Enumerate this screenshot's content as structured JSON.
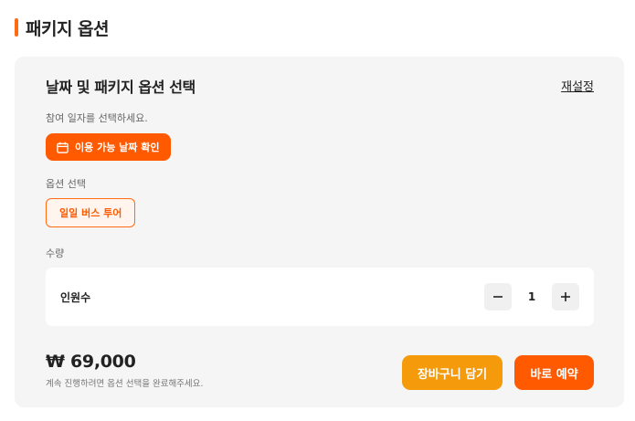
{
  "section": {
    "title": "패키지 옵션"
  },
  "panel": {
    "heading": "날짜 및 패키지 옵션 선택",
    "reset_label": "재설정",
    "date_label": "참여 일자를 선택하세요.",
    "date_button_label": "이용 가능 날짜 확인",
    "date_button_icon": "calendar-icon",
    "option_label": "옵션 선택",
    "options": [
      {
        "label": "일일 버스 투어",
        "selected": true
      }
    ],
    "quantity_label": "수량",
    "quantity": {
      "name": "인원수",
      "value": "1",
      "minus_icon": "minus-icon",
      "plus_icon": "plus-icon"
    },
    "price": "₩ 69,000",
    "hint": "계속 진행하려면 옵션 선택을 완료해주세요.",
    "cart_button_label": "장바구니 담기",
    "book_button_label": "바로 예약"
  },
  "colors": {
    "accent": "#ff5a00",
    "cart": "#f59a0a",
    "panel_bg": "#f5f5f5"
  }
}
